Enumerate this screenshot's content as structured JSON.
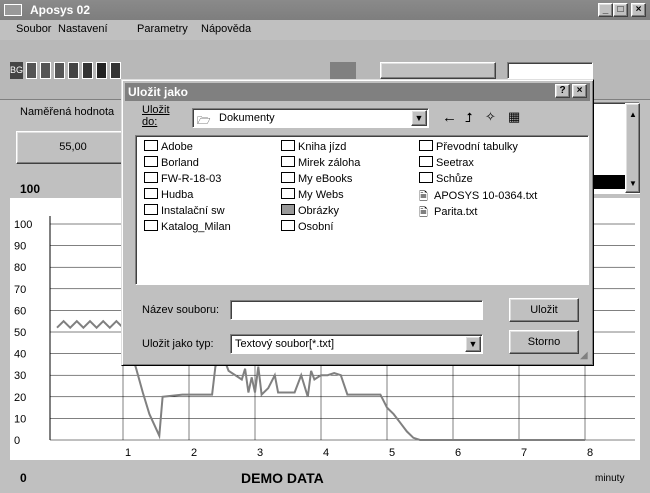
{
  "window": {
    "title": "Aposys 02",
    "min": "_",
    "max": "□",
    "close": "×"
  },
  "menu": [
    {
      "label": "Soubor"
    },
    {
      "label": "Nastavení"
    },
    {
      "label": "Parametry"
    },
    {
      "label": "Nápověda"
    }
  ],
  "toolbar": {
    "bg_label": "BG"
  },
  "panel": {
    "measured_label": "Naměřená hodnota",
    "measured_value": "55,00"
  },
  "chart_header": {
    "top_value": "100"
  },
  "chart_data": {
    "type": "line",
    "xlabel": "minuty",
    "title": "DEMO DATA",
    "xlim": [
      0,
      9
    ],
    "ylim": [
      0,
      100
    ],
    "x_ticks": [
      "1",
      "2",
      "3",
      "4",
      "5",
      "6",
      "7",
      "8"
    ],
    "y_ticks": [
      "0",
      "10",
      "20",
      "30",
      "40",
      "50",
      "60",
      "70",
      "80",
      "90",
      "100"
    ],
    "series": [
      {
        "color": "#808080",
        "points": [
          [
            0,
            52
          ],
          [
            0.1,
            55
          ],
          [
            0.2,
            52
          ],
          [
            0.3,
            55
          ],
          [
            0.4,
            52
          ],
          [
            0.5,
            55
          ],
          [
            0.6,
            52
          ],
          [
            0.7,
            55
          ],
          [
            0.8,
            52
          ],
          [
            0.9,
            55
          ],
          [
            1.0,
            52
          ],
          [
            1.1,
            43
          ],
          [
            1.2,
            33
          ],
          [
            1.3,
            22
          ],
          [
            1.4,
            12
          ],
          [
            1.55,
            2
          ],
          [
            1.6,
            20
          ],
          [
            1.9,
            21
          ],
          [
            2.2,
            21
          ],
          [
            2.35,
            21
          ],
          [
            2.4,
            34
          ],
          [
            2.5,
            40
          ],
          [
            2.6,
            32
          ],
          [
            2.8,
            28
          ],
          [
            2.85,
            33
          ],
          [
            2.9,
            22
          ],
          [
            2.95,
            29
          ],
          [
            3.0,
            22
          ],
          [
            3.05,
            34
          ],
          [
            3.1,
            21
          ],
          [
            3.2,
            24
          ],
          [
            3.3,
            30
          ],
          [
            3.35,
            22
          ],
          [
            3.6,
            22
          ],
          [
            3.7,
            30
          ],
          [
            3.8,
            20
          ],
          [
            3.85,
            32
          ],
          [
            3.9,
            28
          ],
          [
            4.0,
            30
          ],
          [
            4.1,
            30
          ],
          [
            4.2,
            31
          ],
          [
            4.3,
            30
          ],
          [
            4.4,
            21
          ],
          [
            4.5,
            21
          ],
          [
            4.7,
            21
          ],
          [
            4.9,
            21
          ],
          [
            4.95,
            18
          ],
          [
            5.0,
            15
          ],
          [
            5.1,
            12
          ],
          [
            5.2,
            8
          ],
          [
            5.3,
            4
          ],
          [
            5.4,
            1
          ],
          [
            5.5,
            0
          ],
          [
            6.0,
            0
          ],
          [
            8.0,
            0
          ]
        ]
      }
    ]
  },
  "bottom": {
    "left_value": "0",
    "demo": "DEMO DATA",
    "unit": "minuty"
  },
  "dialog": {
    "title": "Uložit jako",
    "help": "?",
    "close": "×",
    "save_in_label": "Uložit do:",
    "location": "Dokumenty",
    "files": [
      {
        "name": "Adobe",
        "type": "folder"
      },
      {
        "name": "Borland",
        "type": "folder"
      },
      {
        "name": "FW-R-18-03",
        "type": "folder"
      },
      {
        "name": "Hudba",
        "type": "folder"
      },
      {
        "name": "Instalační sw",
        "type": "folder"
      },
      {
        "name": "Katalog_Milan",
        "type": "folder"
      },
      {
        "name": "Kniha jízd",
        "type": "folder"
      },
      {
        "name": "Mirek záloha",
        "type": "folder"
      },
      {
        "name": "My eBooks",
        "type": "folder"
      },
      {
        "name": "My Webs",
        "type": "folder"
      },
      {
        "name": "Obrázky",
        "type": "folder-special"
      },
      {
        "name": "Osobní",
        "type": "folder"
      },
      {
        "name": "Převodní tabulky",
        "type": "folder"
      },
      {
        "name": "Seetrax",
        "type": "folder"
      },
      {
        "name": "Schůze",
        "type": "folder"
      },
      {
        "name": "APOSYS 10-0364.txt",
        "type": "file"
      },
      {
        "name": "Parita.txt",
        "type": "file"
      }
    ],
    "filename_label": "Název souboru:",
    "filename_value": "",
    "filetype_label": "Uložit jako typ:",
    "filetype_value": "Textový soubor[*.txt]",
    "save_button": "Uložit",
    "cancel_button": "Storno"
  },
  "colors": {
    "accent": "#808080",
    "chart_line": "#808080",
    "window_bg": "#c0c0c0"
  }
}
